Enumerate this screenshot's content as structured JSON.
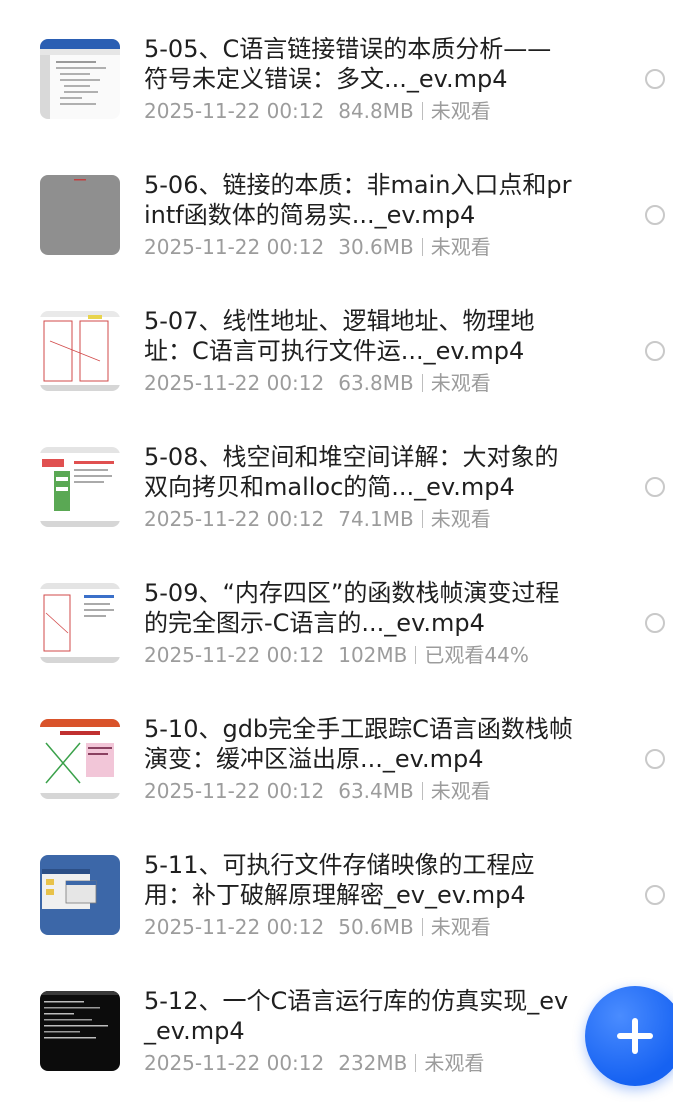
{
  "videos": [
    {
      "title": "5-05、C语言链接错误的本质分析——符号未定义错误：多文..._ev.mp4",
      "date": "2025-11-22 00:12",
      "size": "84.8MB",
      "status": "未观看",
      "thumb": "document-thumbnail"
    },
    {
      "title": "5-06、链接的本质：非main入口点和printf函数体的简易实..._ev.mp4",
      "date": "2025-11-22 00:12",
      "size": "30.6MB",
      "status": "未观看",
      "thumb": "gray-thumbnail"
    },
    {
      "title": "5-07、线性地址、逻辑地址、物理地址：C语言可执行文件运..._ev.mp4",
      "date": "2025-11-22 00:12",
      "size": "63.8MB",
      "status": "未观看",
      "thumb": "slide-thumbnail"
    },
    {
      "title": "5-08、栈空间和堆空间详解：大对象的双向拷贝和malloc的简..._ev.mp4",
      "date": "2025-11-22 00:12",
      "size": "74.1MB",
      "status": "未观看",
      "thumb": "slide-thumbnail"
    },
    {
      "title": "5-09、“内存四区”的函数栈帧演变过程的完全图示-C语言的..._ev.mp4",
      "date": "2025-11-22 00:12",
      "size": "102MB",
      "status": "已观看44%",
      "thumb": "slide-thumbnail"
    },
    {
      "title": "5-10、gdb完全手工跟踪C语言函数栈帧演变：缓冲区溢出原..._ev.mp4",
      "date": "2025-11-22 00:12",
      "size": "63.4MB",
      "status": "未观看",
      "thumb": "slide-thumbnail"
    },
    {
      "title": "5-11、可执行文件存储映像的工程应用：补丁破解原理解密_ev_ev.mp4",
      "date": "2025-11-22 00:12",
      "size": "50.6MB",
      "status": "未观看",
      "thumb": "desktop-thumbnail"
    },
    {
      "title": "5-12、一个C语言运行库的仿真实现_ev_ev.mp4",
      "date": "2025-11-22 00:12",
      "size": "232MB",
      "status": "未观看",
      "thumb": "terminal-thumbnail"
    }
  ],
  "fab": {
    "icon": "plus-icon",
    "color": "#1662f2"
  },
  "colors": {
    "title": "#1f1f1f",
    "meta": "#9c9c9c",
    "radio": "#c9c9c9"
  }
}
